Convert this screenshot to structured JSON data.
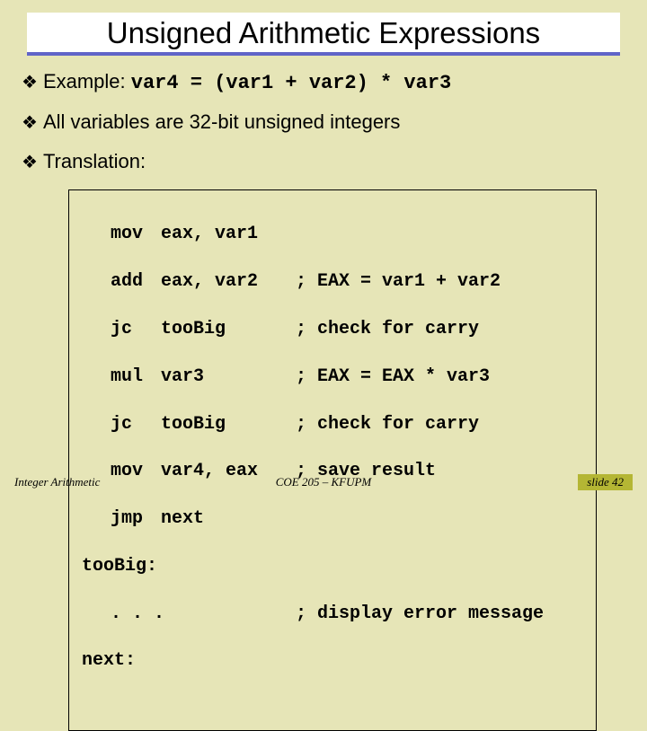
{
  "title": "Unsigned Arithmetic Expressions",
  "bullets": {
    "example_label": "Example:",
    "example_code": "var4 = (var1 + var2) * var3",
    "all_vars": "All variables are 32-bit unsigned integers",
    "translation": "Translation:"
  },
  "code": {
    "lines": [
      {
        "inst": "mov",
        "args": "eax, var1",
        "cmt": ""
      },
      {
        "inst": "add",
        "args": "eax, var2",
        "cmt": "; EAX = var1 + var2"
      },
      {
        "inst": "jc",
        "args": "tooBig",
        "cmt": "; check for carry"
      },
      {
        "inst": "mul",
        "args": "var3",
        "cmt": "; EAX = EAX * var3"
      },
      {
        "inst": "jc",
        "args": "tooBig",
        "cmt": "; check for carry"
      },
      {
        "inst": "mov",
        "args": "var4, eax",
        "cmt": "; save result"
      },
      {
        "inst": "jmp",
        "args": "next",
        "cmt": ""
      }
    ],
    "label_toobig": "tooBig:",
    "ellipsis": ". . .",
    "ellipsis_cmt": "; display error message",
    "label_next": "next:"
  },
  "footer": {
    "left": "Integer Arithmetic",
    "center": "COE 205 – KFUPM",
    "right": "slide 42"
  }
}
